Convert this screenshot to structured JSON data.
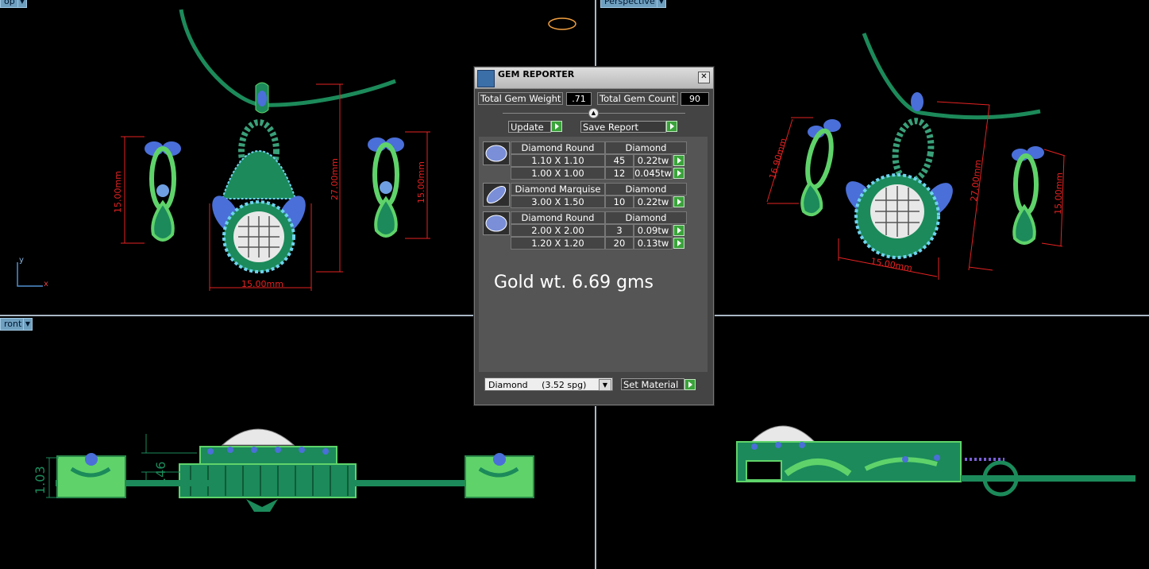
{
  "viewports": {
    "top": {
      "label": "op"
    },
    "perspective": {
      "label": "Perspective"
    },
    "front": {
      "label": "ront"
    }
  },
  "dimensions": {
    "top_earring_left": "15.00mm",
    "top_pendant_height": "27.00mm",
    "top_earring_right": "15.00mm",
    "top_pendant_width": "15.00mm",
    "persp_earring_left": "16.90mm",
    "persp_pendant_height": "27.00mm",
    "persp_earring_right": "15.00mm",
    "persp_pendant_width": "15.00mm",
    "front_height_a": "1.03",
    "front_height_b": ".46"
  },
  "axes": {
    "y": "y",
    "x": "x"
  },
  "gem_reporter": {
    "title": "GEM REPORTER",
    "close": "✕",
    "total_weight_label": "Total Gem Weight",
    "total_weight_value": ".71",
    "total_count_label": "Total Gem Count",
    "total_count_value": "90",
    "update_label": "Update",
    "save_report_label": "Save Report",
    "groups": [
      {
        "shape": "Diamond Round",
        "material": "Diamond",
        "rows": [
          {
            "size": "1.10 X 1.10",
            "count": "45",
            "weight": "0.22tw"
          },
          {
            "size": "1.00 X 1.00",
            "count": "12",
            "weight": "0.045tw"
          }
        ]
      },
      {
        "shape": "Diamond Marquise",
        "material": "Diamond",
        "rows": [
          {
            "size": "3.00 X 1.50",
            "count": "10",
            "weight": "0.22tw"
          }
        ]
      },
      {
        "shape": "Diamond Round",
        "material": "Diamond",
        "rows": [
          {
            "size": "2.00 X 2.00",
            "count": "3",
            "weight": "0.09tw"
          },
          {
            "size": "1.20 X 1.20",
            "count": "20",
            "weight": "0.13tw"
          }
        ]
      }
    ],
    "gold_weight": "Gold wt. 6.69 gms",
    "material_select": "Diamond     (3.52 spg)",
    "set_material_label": "Set Material"
  },
  "colors": {
    "metal": "#1c8a5a",
    "metal_light": "#5fd36a",
    "stone_blue": "#4a6fd8",
    "dim_red": "#e52222",
    "panel_bg": "#444444"
  }
}
